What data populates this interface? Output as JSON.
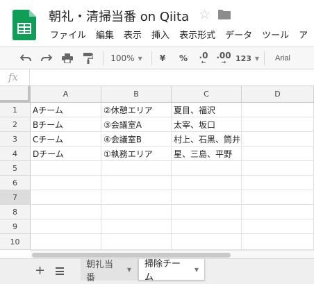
{
  "title_bar": {
    "doc_title": "朝礼・清掃当番 on Qiita",
    "star_icon": "star-icon",
    "folder_icon": "folder-icon"
  },
  "menu": {
    "items": [
      "ファイル",
      "編集",
      "表示",
      "挿入",
      "表示形式",
      "データ",
      "ツール",
      "ア"
    ]
  },
  "toolbar": {
    "undo_icon": "undo-icon",
    "redo_icon": "redo-icon",
    "print_icon": "print-icon",
    "paint_format_icon": "paint-format-icon",
    "zoom": "100%",
    "currency": "¥",
    "percent": "%",
    "decrease_decimal": ".0",
    "increase_decimal": ".00",
    "more_formats": "123",
    "font": "Arial"
  },
  "formula_bar": {
    "fx_label": "fx",
    "value": ""
  },
  "grid": {
    "columns": [
      "A",
      "B",
      "C",
      "D"
    ],
    "rows": [
      "1",
      "2",
      "3",
      "4",
      "5",
      "6",
      "7",
      "8",
      "9",
      "10"
    ],
    "cells": [
      [
        "Aチーム",
        "②休憩エリア",
        "夏目、福沢",
        ""
      ],
      [
        "Bチーム",
        "③会議室A",
        "太宰、坂口",
        ""
      ],
      [
        "Cチーム",
        "④会議室B",
        "村上、石黒、筒井",
        ""
      ],
      [
        "Dチーム",
        "①執務エリア",
        "星、三島、平野",
        ""
      ]
    ],
    "selected_row": "7"
  },
  "sheet_tabs": {
    "add_icon": "+",
    "list_icon": "all-sheets-icon",
    "tabs": [
      {
        "label": "朝礼当番",
        "active": false
      },
      {
        "label": "掃除チーム",
        "active": true
      }
    ]
  },
  "colors": {
    "sheets_green": "#0F9D58",
    "header_bg": "#f3f3f3",
    "selected_row_header": "#dcdcdc"
  }
}
